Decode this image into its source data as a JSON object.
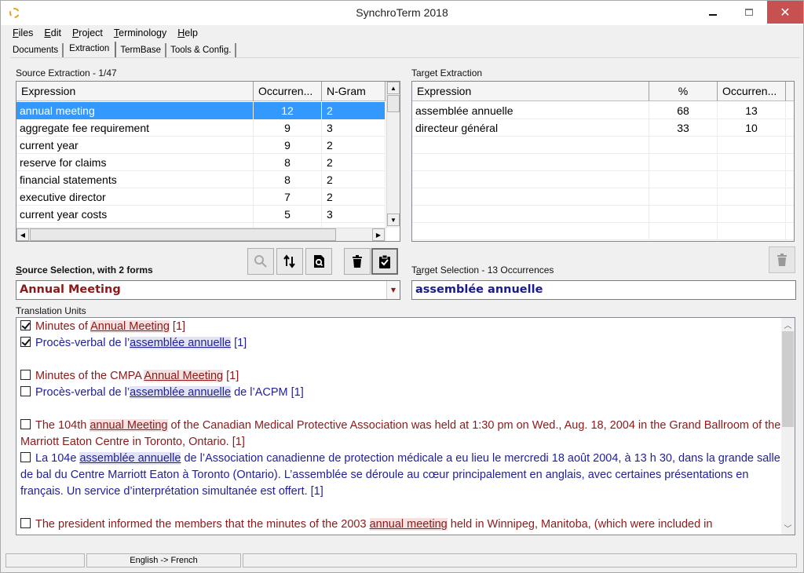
{
  "window": {
    "title": "SynchroTerm 2018",
    "icon": "app-logo-icon",
    "controls": {
      "minimize": "minimize-icon",
      "maximize": "maximize-icon",
      "close": "close-icon",
      "close_glyph": "✕"
    }
  },
  "menubar": {
    "items": [
      {
        "accel": "F",
        "rest": "iles"
      },
      {
        "accel": "E",
        "rest": "dit"
      },
      {
        "accel": "P",
        "rest": "roject"
      },
      {
        "accel": "T",
        "rest": "erminology"
      },
      {
        "accel": "H",
        "rest": "elp"
      }
    ]
  },
  "tabs": [
    {
      "label": "Documents",
      "active": false
    },
    {
      "label": "Extraction",
      "active": true
    },
    {
      "label": "TermBase",
      "active": false
    },
    {
      "label": "Tools & Config.",
      "active": false
    }
  ],
  "source_extraction": {
    "label": "Source Extraction - 1/47",
    "columns": [
      "Expression",
      "Occurren...",
      "N-Gram"
    ],
    "rows": [
      {
        "expression": "annual meeting",
        "occurrences": "12",
        "ngram": "2",
        "selected": true
      },
      {
        "expression": "aggregate fee requirement",
        "occurrences": "9",
        "ngram": "3"
      },
      {
        "expression": "current year",
        "occurrences": "9",
        "ngram": "2"
      },
      {
        "expression": "reserve for claims",
        "occurrences": "8",
        "ngram": "2"
      },
      {
        "expression": "financial statements",
        "occurrences": "8",
        "ngram": "2"
      },
      {
        "expression": "executive director",
        "occurrences": "7",
        "ngram": "2"
      },
      {
        "expression": "current year costs",
        "occurrences": "5",
        "ngram": "3"
      }
    ]
  },
  "target_extraction": {
    "label": "Target Extraction",
    "columns": [
      "Expression",
      "%",
      "Occurren..."
    ],
    "rows": [
      {
        "expression": "assemblée annuelle",
        "percent": "68",
        "occurrences": "13"
      },
      {
        "expression": "directeur général",
        "percent": "33",
        "occurrences": "10"
      }
    ]
  },
  "toolbar": {
    "buttons": [
      {
        "name": "search-button",
        "icon": "search-icon",
        "disabled": true
      },
      {
        "name": "swap-button",
        "icon": "swap-arrows-icon"
      },
      {
        "name": "preview-button",
        "icon": "document-search-icon"
      },
      {
        "name": "delete-button",
        "icon": "trash-icon"
      },
      {
        "name": "validate-button",
        "icon": "clipboard-check-icon",
        "pressed": true
      }
    ],
    "target_delete": {
      "icon": "trash-icon",
      "disabled": true
    }
  },
  "source_selection": {
    "label_accel": "S",
    "label_rest": "ource Selection, with 2 forms",
    "value": "Annual Meeting",
    "color": "#8b1a1a"
  },
  "target_selection": {
    "label_pre": "T",
    "label_accel": "a",
    "label_rest": "rget Selection - 13 Occurrences",
    "value": "assemblée annuelle",
    "color": "#1a1a8b"
  },
  "translation_units": {
    "label": "Translation Units",
    "items": [
      {
        "lang": "src",
        "checked": true,
        "pre": "Minutes of ",
        "term": "Annual Meeting",
        "post": " [1]"
      },
      {
        "lang": "tgt",
        "checked": true,
        "pre": "Procès-verbal de l’",
        "term": "assemblée annuelle",
        "post": " [1]"
      },
      {
        "gap": true
      },
      {
        "lang": "src",
        "checked": false,
        "pre": "Minutes of the CMPA ",
        "term": "Annual Meeting",
        "post": " [1]"
      },
      {
        "lang": "tgt",
        "checked": false,
        "pre": "Procès-verbal de l’",
        "term": "assemblée annuelle",
        "post": " de l’ACPM [1]"
      },
      {
        "gap": true
      },
      {
        "lang": "src",
        "checked": false,
        "pre": "The 104th ",
        "term": "annual Meeting",
        "post": " of the Canadian Medical Protective Association was held at 1:30 pm on Wed., Aug. 18, 2004 in the Grand Ballroom of the Marriott Eaton Centre in Toronto, Ontario. [1]"
      },
      {
        "lang": "tgt",
        "checked": false,
        "pre": "La 104e ",
        "term": "assemblée annuelle",
        "post": " de l’Association canadienne de protection médicale a eu lieu le mercredi 18 août 2004, à 13 h 30, dans la grande salle de bal du Centre Marriott Eaton à Toronto (Ontario). L’assemblée se déroule au cœur principalement en anglais, avec certaines présentations en français. Un service d’interprétation simultanée est offert. [1]"
      },
      {
        "gap": true
      },
      {
        "lang": "src",
        "checked": false,
        "pre": "The president informed the members that the minutes of the 2003 ",
        "term": "annual meeting",
        "post": " held in Winnipeg, Manitoba, (which were included in"
      }
    ]
  },
  "statusbar": {
    "panes": [
      "",
      "English -> French",
      ""
    ]
  },
  "colors": {
    "selection": "#3399ff",
    "source_text": "#8b1a1a",
    "target_text": "#1f1f99",
    "source_highlight": "#f4e1e1",
    "target_highlight": "#e3e3f6",
    "close_button": "#c75050"
  }
}
